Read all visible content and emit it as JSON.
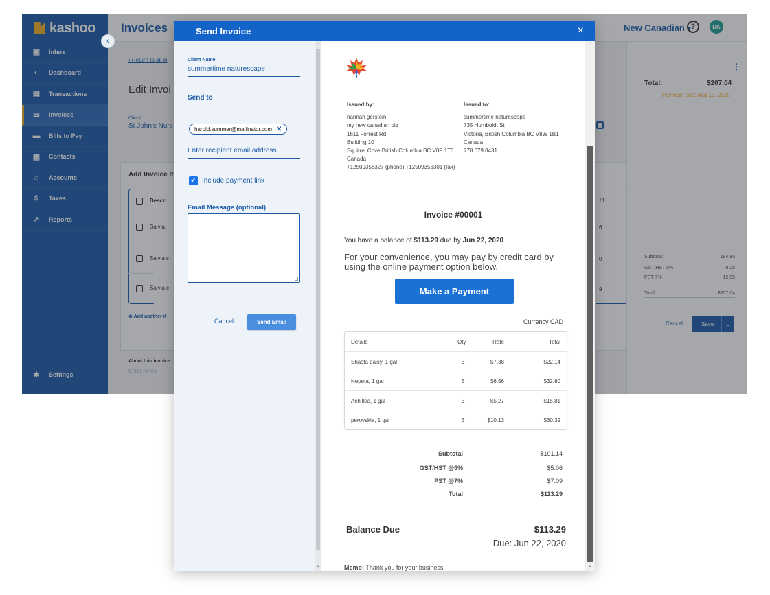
{
  "app": {
    "logo_text": "kashoo",
    "page_title": "Invoices",
    "company": "New Canadian",
    "company_caret": "▾",
    "help": "?",
    "avatar": "DK"
  },
  "sidebar": {
    "items": [
      {
        "label": "Inbox",
        "icon": "inbox-icon"
      },
      {
        "label": "Dashboard",
        "icon": "dashboard-icon"
      },
      {
        "label": "Transactions",
        "icon": "transactions-icon"
      },
      {
        "label": "Invoices",
        "icon": "invoices-icon"
      },
      {
        "label": "Bills to Pay",
        "icon": "bills-icon"
      },
      {
        "label": "Contacts",
        "icon": "contacts-icon"
      },
      {
        "label": "Accounts",
        "icon": "accounts-icon"
      },
      {
        "label": "Taxes",
        "icon": "taxes-icon"
      },
      {
        "label": "Reports",
        "icon": "reports-icon"
      }
    ],
    "settings": "Settings"
  },
  "background": {
    "return_link": "Return to all in",
    "edit_title": "Edit Invoi",
    "client_label": "Client",
    "client_value": "St John's Nurs",
    "add_items": "Add Invoice It",
    "col_desc": "Descri",
    "rows": [
      "Salvia,",
      "Salvia s",
      "Salvia c"
    ],
    "add_another": "Add another it",
    "about": "About this invoice",
    "notes_placeholder": "Enter notes",
    "right_col_frag": [
      "nt",
      "6",
      "0",
      "9"
    ]
  },
  "right_panel": {
    "total_label": "Total:",
    "total_value": "$207.04",
    "payment_due": "Payment due: Aug 15, 2020",
    "summary": [
      {
        "label": "Subtotal:",
        "value": "184.85"
      },
      {
        "label": "GST/HST 5%",
        "value": "9.25"
      },
      {
        "label": "PST 7%",
        "value": "12.95"
      }
    ],
    "total_row": {
      "label": "Total:",
      "value": "$207.04"
    },
    "cancel": "Cancel",
    "save": "Save"
  },
  "modal": {
    "title": "Send Invoice",
    "close": "×",
    "client_name_label": "Client Name",
    "client_name_value": "summertime naturescape",
    "send_to_label": "Send to",
    "recipient_chip": "harold.summer@mailinator.com",
    "recipient_placeholder": "Enter recipient email address",
    "include_payment_link": "Include payment link",
    "email_message_label": "Email Message (optional)",
    "cancel": "Cancel",
    "send": "Send Email"
  },
  "preview": {
    "issued_by_label": "Issued by:",
    "issued_by_lines": [
      "hannah gerstein",
      "my new canadian biz",
      "1611 Forrest Rd",
      "Building 10",
      "Squirrel Cove British Columbia BC V0P 1T0",
      "Canada",
      "+12509356327 (phone) +12509356301 (fax)"
    ],
    "issued_to_label": "Issued to:",
    "issued_to_lines": [
      "summertime naturescape",
      "735 Humboldt St",
      "Victoria, British Columbia BC V8W 1B1",
      "Canada",
      "778.679.8431"
    ],
    "invoice_title": "Invoice #00001",
    "balance_prefix": "You have a balance of ",
    "balance_amount": "$113.29",
    "balance_mid": " due by ",
    "balance_date": "Jun 22, 2020",
    "convenience": "For your convenience, you may pay by credit card by using the online payment option below.",
    "pay_button": "Make a Payment",
    "currency_label": "Currency",
    "currency_value": "CAD",
    "table_headers": [
      "Details",
      "Qty",
      "Rate",
      "Total"
    ],
    "items": [
      {
        "details": "Shasta daisy, 1 gal",
        "qty": "3",
        "rate": "$7.38",
        "total": "$22.14"
      },
      {
        "details": "Nepeta, 1 gal",
        "qty": "5",
        "rate": "$6.56",
        "total": "$32.80"
      },
      {
        "details": "Achillea, 1 gal",
        "qty": "3",
        "rate": "$5.27",
        "total": "$15.81"
      },
      {
        "details": "perovskia, 1 gal",
        "qty": "3",
        "rate": "$10.13",
        "total": "$30.39"
      }
    ],
    "totals": [
      {
        "label": "Subtotal",
        "value": "$101.14",
        "bold": false
      },
      {
        "label": "GST/HST @5%",
        "value": "$5.06",
        "bold": false
      },
      {
        "label": "PST @7%",
        "value": "$7.09",
        "bold": false
      },
      {
        "label": "Total",
        "value": "$113.29",
        "bold": true
      }
    ],
    "balance_due_label": "Balance Due",
    "balance_due_value": "$113.29",
    "due_text": "Due: Jun 22, 2020",
    "memo_label": "Memo:",
    "memo_text": " Thank you for your business!"
  },
  "colors": {
    "brand": "#1a5aa6",
    "accent": "#f5b021",
    "header": "#1463c8",
    "pay_button": "#1a73d4"
  }
}
